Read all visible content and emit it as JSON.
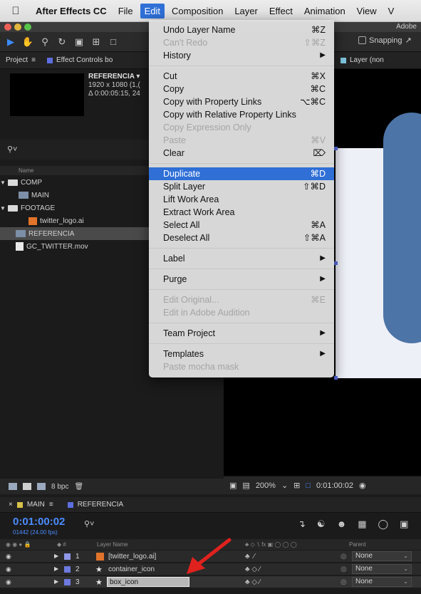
{
  "menubar": {
    "app": "After Effects CC",
    "items": [
      "File",
      "Edit",
      "Composition",
      "Layer",
      "Effect",
      "Animation",
      "View",
      "V"
    ]
  },
  "window": {
    "title": "Adobe"
  },
  "toolbar": {
    "snapping_label": "Snapping"
  },
  "project_panel": {
    "tab_project": "Project",
    "tab_effect_controls": "Effect Controls bo",
    "tab_layer": "Layer (non",
    "info_name": "REFERENCIA ▾",
    "info_size": "1920 x 1080 (1,(",
    "info_duration": "Δ 0:00:05:15, 24",
    "column_name": "Name",
    "items": [
      {
        "label": "COMP",
        "type": "folder",
        "indent": 0
      },
      {
        "label": "MAIN",
        "type": "comp",
        "indent": 1
      },
      {
        "label": "FOOTAGE",
        "type": "folder",
        "indent": 0
      },
      {
        "label": "twitter_logo.ai",
        "type": "ai",
        "indent": 1
      },
      {
        "label": "REFERENCIA",
        "type": "comp",
        "indent": 0,
        "selected": true
      },
      {
        "label": "GC_TWITTER.mov",
        "type": "mov",
        "indent": 0
      }
    ],
    "bpc": "8 bpc"
  },
  "viewer": {
    "zoom": "200%",
    "timecode": "0:01:00:02"
  },
  "edit_menu": {
    "groups": [
      [
        {
          "label": "Undo Layer Name",
          "shortcut": "⌘Z"
        },
        {
          "label": "Can't Redo",
          "shortcut": "⇧⌘Z",
          "disabled": true
        },
        {
          "label": "History",
          "submenu": true
        }
      ],
      [
        {
          "label": "Cut",
          "shortcut": "⌘X"
        },
        {
          "label": "Copy",
          "shortcut": "⌘C"
        },
        {
          "label": "Copy with Property Links",
          "shortcut": "⌥⌘C"
        },
        {
          "label": "Copy with Relative Property Links"
        },
        {
          "label": "Copy Expression Only",
          "disabled": true
        },
        {
          "label": "Paste",
          "shortcut": "⌘V",
          "disabled": true
        },
        {
          "label": "Clear",
          "shortcut": "⌦"
        }
      ],
      [
        {
          "label": "Duplicate",
          "shortcut": "⌘D",
          "highlight": true
        },
        {
          "label": "Split Layer",
          "shortcut": "⇧⌘D"
        },
        {
          "label": "Lift Work Area"
        },
        {
          "label": "Extract Work Area"
        },
        {
          "label": "Select All",
          "shortcut": "⌘A"
        },
        {
          "label": "Deselect All",
          "shortcut": "⇧⌘A"
        }
      ],
      [
        {
          "label": "Label",
          "submenu": true
        }
      ],
      [
        {
          "label": "Purge",
          "submenu": true
        }
      ],
      [
        {
          "label": "Edit Original...",
          "shortcut": "⌘E",
          "disabled": true
        },
        {
          "label": "Edit in Adobe Audition",
          "disabled": true
        }
      ],
      [
        {
          "label": "Team Project",
          "submenu": true
        }
      ],
      [
        {
          "label": "Templates",
          "submenu": true
        },
        {
          "label": "Paste mocha mask",
          "disabled": true
        }
      ]
    ]
  },
  "timeline": {
    "tab_main": "MAIN",
    "tab_referencia": "REFERENCIA",
    "current_time": "0:01:00:02",
    "frame_info": "01442 (24.00 fps)",
    "col_layer_name": "Layer Name",
    "col_parent": "Parent",
    "layers": [
      {
        "num": "1",
        "name": "[twitter_logo.ai]",
        "kind": "ai",
        "parent": "None"
      },
      {
        "num": "2",
        "name": "container_icon",
        "kind": "shape",
        "parent": "None"
      },
      {
        "num": "3",
        "name": "box_icon",
        "kind": "shape",
        "parent": "None",
        "editing": true
      }
    ]
  },
  "colors": {
    "accent_blue": "#2f6fd6",
    "timecode_blue": "#4b8cff",
    "shape_blue": "#4c74a6",
    "arrow_red": "#e0221e"
  }
}
